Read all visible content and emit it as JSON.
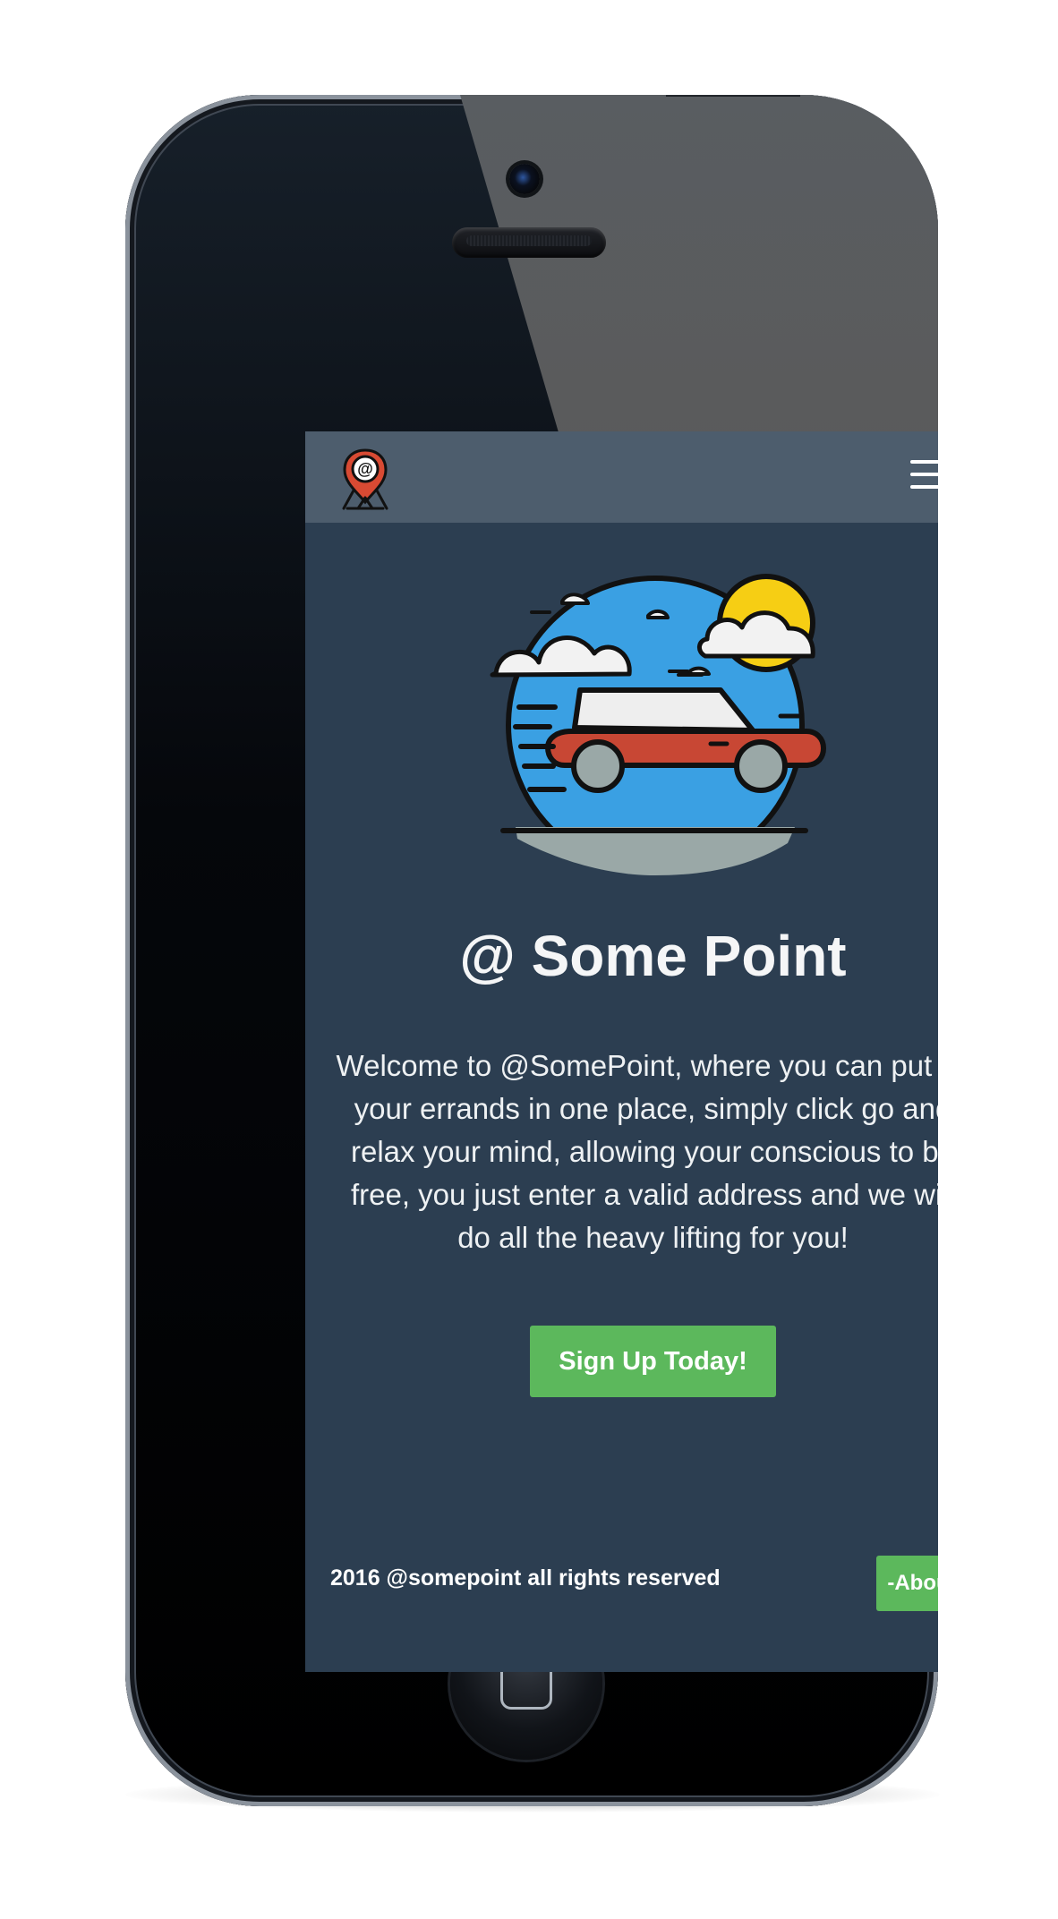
{
  "app": {
    "title": "@ Some Point",
    "description": "Welcome to @SomePoint, where you can put all your errands in one place, simply click go and relax your mind, allowing your conscious to be free, you just enter a valid address and we will do all the heavy lifting for you!"
  },
  "header": {
    "logo_icon": "map-pin-at-icon",
    "menu_icon": "hamburger-menu-icon"
  },
  "hero": {
    "illustration": "car-in-globe-illustration"
  },
  "actions": {
    "signup_label": "Sign Up Today!"
  },
  "footer": {
    "copyright": "2016 @somepoint all rights reserved",
    "about_label": "-About-"
  },
  "colors": {
    "page_background": "#ffffff",
    "screen_background": "#2c3e51",
    "navbar_background": "#4d5d6d",
    "accent_green": "#5cb85c",
    "sky_blue": "#3aa0e3",
    "sun_yellow": "#f6ce14",
    "car_red": "#c84734"
  }
}
